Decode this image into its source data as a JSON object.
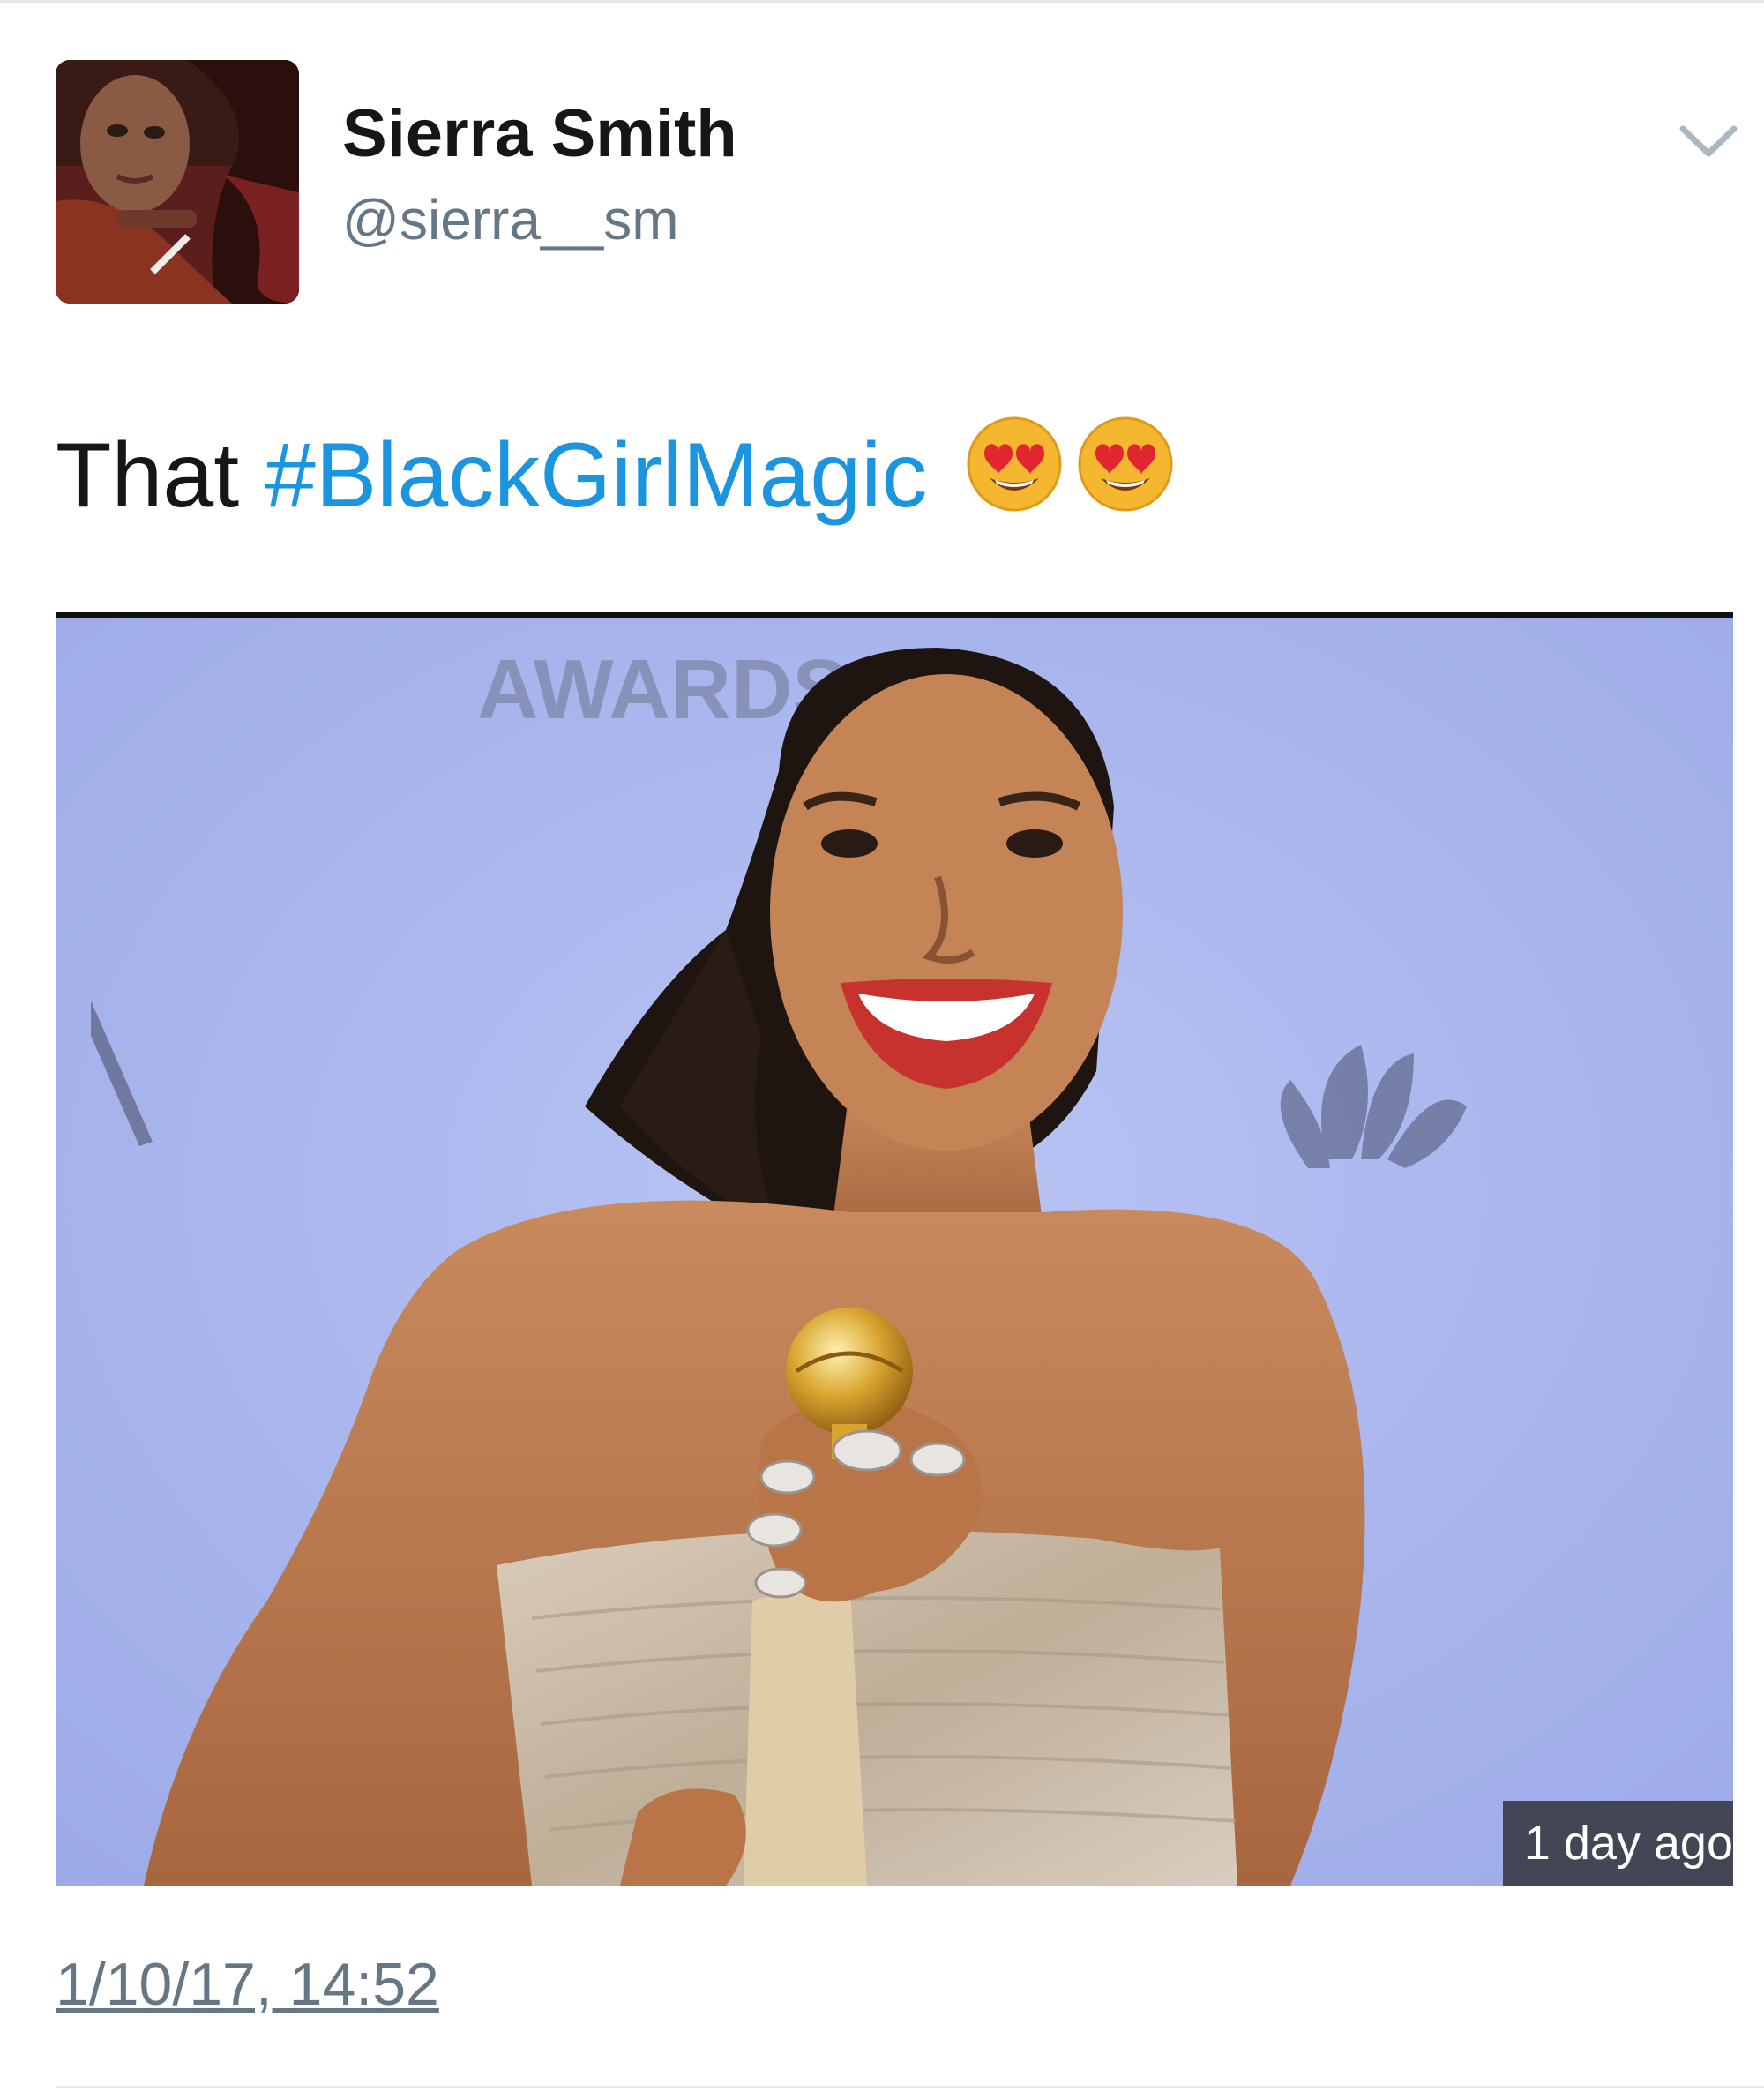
{
  "tweet": {
    "author": {
      "name": "Sierra Smith",
      "handle": "@sierra__sm"
    },
    "text_prefix": "That",
    "hashtag": "#BlackGirlMagic",
    "emojis": [
      "smiling-face-with-heart-eyes",
      "smiling-face-with-heart-eyes"
    ],
    "media": {
      "badge": "1 day ago",
      "backdrop_text": "AWARDS"
    },
    "timestamp": "1/10/17, 14:52"
  },
  "colors": {
    "hashtag": "#1b95e0",
    "name": "#14171a",
    "secondary": "#657786",
    "backdrop": "#a9b6ef"
  },
  "icons": {
    "menu": "chevron-down-icon"
  }
}
